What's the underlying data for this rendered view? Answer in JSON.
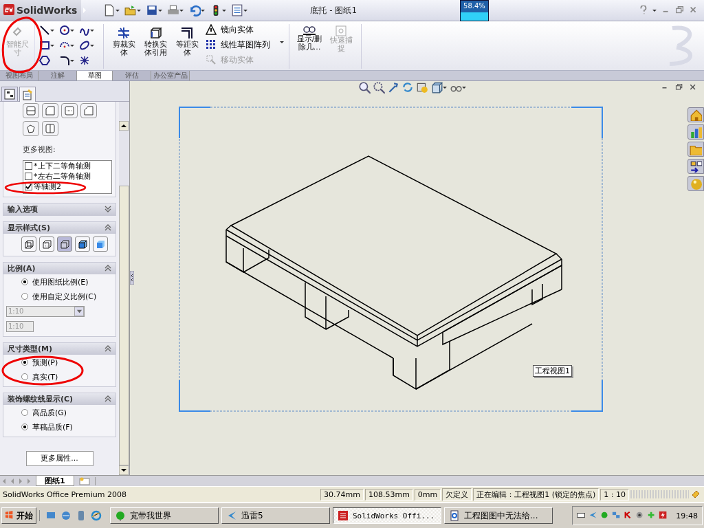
{
  "window": {
    "app_name": "SolidWorks",
    "title": "底托 - 图纸1",
    "meter": "58.4%"
  },
  "ribbon": {
    "items": [
      {
        "kind": "dimension",
        "label": "智能尺寸",
        "disabled": true
      },
      {
        "kind": "large",
        "label": "剪裁实体",
        "disabled": false
      },
      {
        "kind": "large",
        "label": "转换实体引用",
        "disabled": false
      },
      {
        "kind": "large",
        "label": "等距实体",
        "disabled": false
      },
      {
        "kind": "small",
        "label": "镜向实体",
        "disabled": false
      },
      {
        "kind": "small",
        "label": "线性草图阵列",
        "disabled": false
      },
      {
        "kind": "small",
        "label": "移动实体",
        "disabled": true
      },
      {
        "kind": "large",
        "label": "显示/删除几…",
        "disabled": false
      },
      {
        "kind": "large",
        "label": "快速捕捉",
        "disabled": true
      }
    ],
    "tabs": [
      {
        "label": "视图布局",
        "selected": false
      },
      {
        "label": "注解",
        "selected": false
      },
      {
        "label": "草图",
        "selected": true
      },
      {
        "label": "评估",
        "selected": false
      },
      {
        "label": "办公室产品",
        "selected": false
      }
    ]
  },
  "panel": {
    "sections": [
      {
        "kind": "views",
        "label": "更多视图:",
        "items": [
          {
            "label": "*上下二等角轴测",
            "checked": false
          },
          {
            "label": "*左右二等角轴测",
            "checked": false
          },
          {
            "label": "等轴测2",
            "checked": true
          }
        ]
      },
      {
        "kind": "header",
        "title": "输入选项",
        "expanded": false
      },
      {
        "kind": "styles",
        "title": "显示样式(S)",
        "expanded": true,
        "styles": [
          {
            "selected": false
          },
          {
            "selected": false
          },
          {
            "selected": true
          },
          {
            "selected": false
          },
          {
            "selected": false
          }
        ]
      },
      {
        "kind": "scale",
        "title": "比例(A)",
        "expanded": true,
        "options": [
          {
            "label": "使用图纸比例(E)",
            "selected": true
          },
          {
            "label": "使用自定义比例(C)",
            "selected": false
          }
        ],
        "dropdown": {
          "value": "1:10",
          "disabled": true
        },
        "field": {
          "value": "1:10",
          "disabled": true
        }
      },
      {
        "kind": "radios",
        "title": "尺寸类型(M)",
        "expanded": true,
        "options": [
          {
            "label": "预测(P)",
            "selected": true
          },
          {
            "label": "真实(T)",
            "selected": false
          }
        ]
      },
      {
        "kind": "radios",
        "title": "装饰螺纹线显示(C)",
        "expanded": true,
        "options": [
          {
            "label": "高品质(G)",
            "selected": false
          },
          {
            "label": "草稿品质(F)",
            "selected": true
          }
        ]
      },
      {
        "kind": "button",
        "label": "更多属性..."
      }
    ]
  },
  "canvas": {
    "view_label": "工程视图1"
  },
  "sheet_tabs": [
    {
      "label": "图纸1",
      "selected": true
    }
  ],
  "status_bar": {
    "product": "SolidWorks Office Premium 2008",
    "cells": [
      "30.74mm",
      "108.53mm",
      "0mm",
      "欠定义",
      "正在编辑：工程视图1 (锁定的焦点)",
      "1 : 10"
    ]
  },
  "taskbar": {
    "start": "开始",
    "tasks": [
      {
        "label": "宽带我世界",
        "selected": false
      },
      {
        "label": "迅雷5",
        "selected": false
      },
      {
        "label": "SolidWorks Offi...",
        "selected": true
      },
      {
        "label": "工程图图中无法给...",
        "selected": false
      }
    ],
    "clock": "19:48"
  }
}
